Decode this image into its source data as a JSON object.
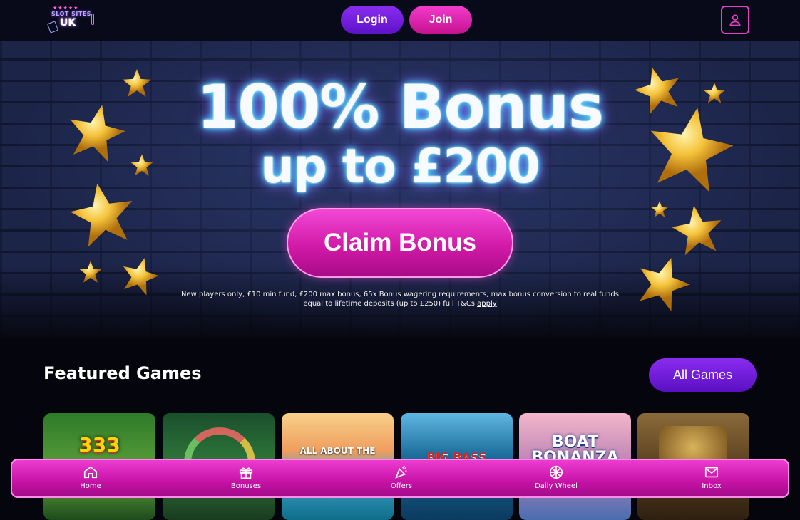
{
  "header": {
    "logo": {
      "stars": "★★★★★",
      "line1": "SLOT SITES",
      "line2": "UK"
    },
    "login_label": "Login",
    "join_label": "Join",
    "account_icon": "user-icon"
  },
  "hero": {
    "title_line1": "100% Bonus",
    "title_line2": "up to £200",
    "cta_label": "Claim Bonus",
    "terms": "New players only, £10 min fund, £200 max bonus, 65x Bonus wagering requirements, max bonus conversion to real funds equal to lifetime deposits (up to £250) full T&Cs ",
    "terms_link": "apply"
  },
  "featured": {
    "title": "Featured Games",
    "all_games_label": "All Games",
    "games": [
      {
        "name": "333",
        "bg": "#2f7a2a"
      },
      {
        "name": "",
        "bg": "#1f6b35"
      },
      {
        "name": "ALL ABOUT THE",
        "bg": "#e8b56a"
      },
      {
        "name": "BIG BASS",
        "bg": "#1b6d9a"
      },
      {
        "name": "BOAT BONANZA",
        "bg": "#c58ab8"
      },
      {
        "name": "",
        "bg": "#6b4c22"
      }
    ]
  },
  "bottom_nav": {
    "items": [
      {
        "label": "Home",
        "icon": "home-icon"
      },
      {
        "label": "Bonuses",
        "icon": "gift-icon"
      },
      {
        "label": "Offers",
        "icon": "party-popper-icon"
      },
      {
        "label": "Daily Wheel",
        "icon": "wheel-icon"
      },
      {
        "label": "Inbox",
        "icon": "envelope-icon"
      }
    ]
  },
  "colors": {
    "accent_pink": "#d21aa8",
    "accent_purple": "#6a18d8",
    "background": "#05060d"
  }
}
